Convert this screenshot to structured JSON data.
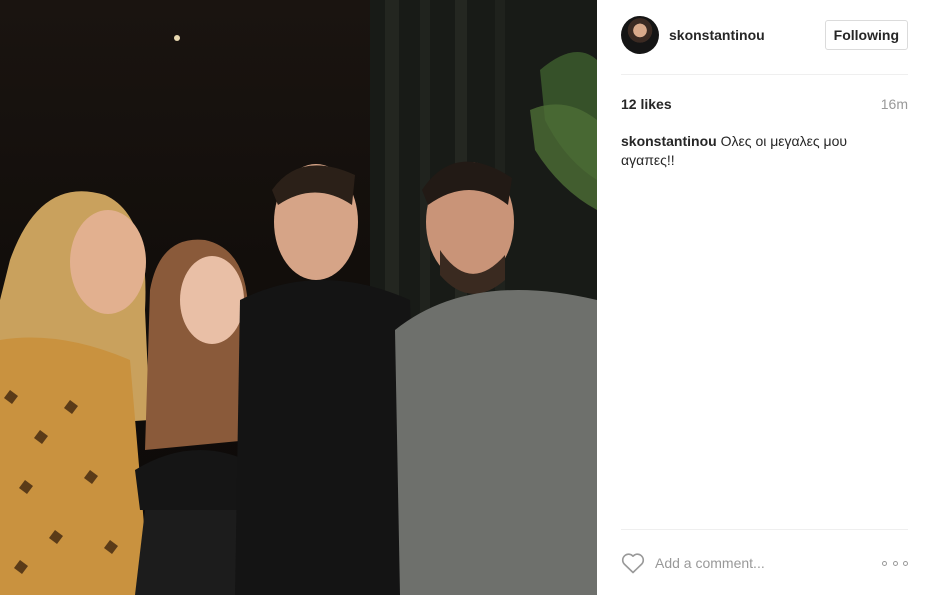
{
  "post": {
    "username": "skonstantinou",
    "follow_label": "Following",
    "likes": "12 likes",
    "time": "16m",
    "caption": {
      "username": "skonstantinou",
      "text": "Ολες οι μεγαλες μου αγαπες!!"
    },
    "comment_placeholder": "Add a comment...",
    "photo_description": "group-photo",
    "colors": {
      "text": "#262626",
      "muted": "#999999",
      "border": "#dbdbdb"
    },
    "icons": [
      "heart-icon",
      "more-options-icon"
    ]
  }
}
